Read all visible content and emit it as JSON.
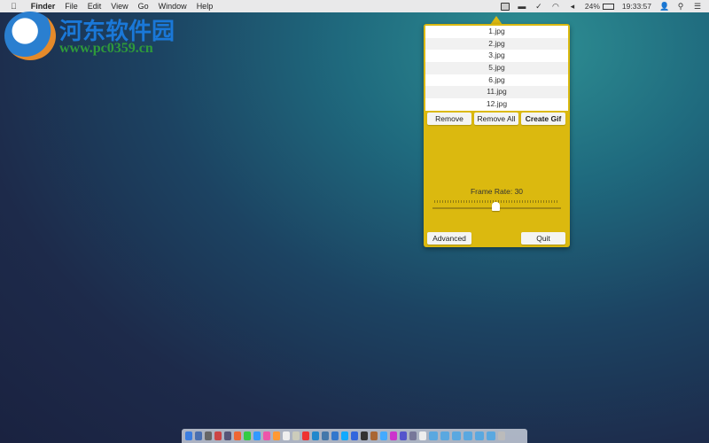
{
  "menubar": {
    "apple": "",
    "app": "Finder",
    "items": [
      "File",
      "Edit",
      "View",
      "Go",
      "Window",
      "Help"
    ],
    "status": {
      "battery": "24%",
      "time": "19:33:57"
    }
  },
  "watermark": {
    "cn": "河东软件园",
    "url": "www.pc0359.cn"
  },
  "popup": {
    "files": [
      "1.jpg",
      "2.jpg",
      "3.jpg",
      "5.jpg",
      "6.jpg",
      "11.jpg",
      "12.jpg"
    ],
    "remove": "Remove",
    "remove_all": "Remove All",
    "create_gif": "Create Gif",
    "frame_rate_label": "Frame Rate: 30",
    "frame_rate": 30,
    "frame_rate_fraction": 0.49,
    "advanced": "Advanced",
    "quit": "Quit",
    "accent": "#dbb90f"
  },
  "dock": {
    "icon_colors": [
      "#3b7de0",
      "#4a6fb0",
      "#666",
      "#c44",
      "#557",
      "#e63",
      "#3c4",
      "#39f",
      "#e5a",
      "#f93",
      "#eee",
      "#ccb",
      "#e33",
      "#28c",
      "#47a",
      "#37c",
      "#1af",
      "#36d",
      "#333",
      "#a63",
      "#4af",
      "#c3c",
      "#55c",
      "#779",
      "#eee"
    ]
  }
}
